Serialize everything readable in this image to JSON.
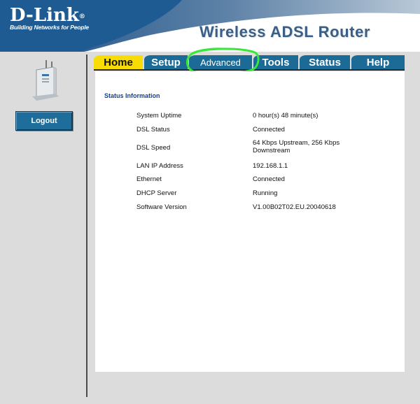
{
  "brand": {
    "name": "D-Link",
    "registered_mark": "®",
    "tagline": "Building Networks for People"
  },
  "product_title": "Wireless ADSL Router",
  "sidebar": {
    "logout_label": "Logout"
  },
  "tabs": [
    {
      "label": "Home",
      "active": true
    },
    {
      "label": "Setup",
      "active": false
    },
    {
      "label": "Advanced",
      "active": false
    },
    {
      "label": "Tools",
      "active": false
    },
    {
      "label": "Status",
      "active": false
    },
    {
      "label": "Help",
      "active": false
    }
  ],
  "status": {
    "title": "Status Information",
    "rows": [
      {
        "label": "System Uptime",
        "value": "0 hour(s) 48 minute(s)"
      },
      {
        "label": "DSL Status",
        "value": "Connected"
      },
      {
        "label": "DSL Speed",
        "value": "64 Kbps Upstream, 256 Kbps Downstream"
      },
      {
        "label": "LAN IP Address",
        "value": "192.168.1.1"
      },
      {
        "label": "Ethernet",
        "value": "Connected"
      },
      {
        "label": "DHCP Server",
        "value": "Running"
      },
      {
        "label": "Software Version",
        "value": "V1.00B02T02.EU.20040618"
      }
    ]
  },
  "colors": {
    "header_blue": "#1f5b93",
    "tab_blue": "#1c6a96",
    "active_tab": "#f7dc06",
    "title_blue": "#3a5f86",
    "section_title": "#163f86",
    "highlight_ring": "#39e639",
    "sidebar_gray": "#dcdcdc"
  },
  "icons": {
    "device": "router-device-icon",
    "highlight": "highlight-circle-annotation"
  }
}
